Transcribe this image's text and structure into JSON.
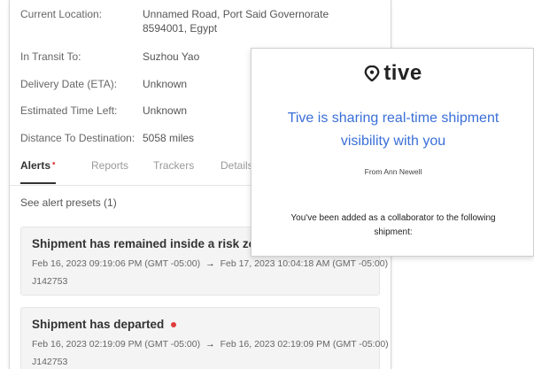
{
  "details": {
    "current_location_label": "Current Location:",
    "current_location_value": "Unnamed Road, Port Said Governorate 8594001, Egypt",
    "in_transit_label": "In Transit To:",
    "in_transit_value": "Suzhou Yao",
    "delivery_date_label": "Delivery Date (ETA):",
    "delivery_date_value": "Unknown",
    "time_left_label": "Estimated Time Left:",
    "time_left_value": "Unknown",
    "distance_label": "Distance To Destination:",
    "distance_value": "5058 miles"
  },
  "tabs": [
    "Alerts",
    "Reports",
    "Trackers",
    "Details"
  ],
  "alerts_dot": "•",
  "presets_text": "See alert presets (1)",
  "alerts": [
    {
      "title": "Shipment has remained inside a risk zone for more",
      "start": "Feb 16, 2023 09:19:06 PM (GMT -05:00)",
      "end": "Feb 17, 2023 10:04:18 AM (GMT -05:00)",
      "id": "J142753"
    },
    {
      "title": "Shipment has departed",
      "start": "Feb 16, 2023 02:19:09 PM (GMT -05:00)",
      "end": "Feb 16, 2023 02:19:09 PM (GMT -05:00)",
      "id": "J142753"
    }
  ],
  "arrow": "→",
  "overlay": {
    "brand": "tive",
    "message": "Tive is sharing real-time shipment visibility with you",
    "from": "From Ann Newell",
    "collab": "You've been added as a collaborator to the following shipment:"
  },
  "colors": {
    "accent": "#3a6fd8",
    "alert_red": "#e03c3c"
  }
}
